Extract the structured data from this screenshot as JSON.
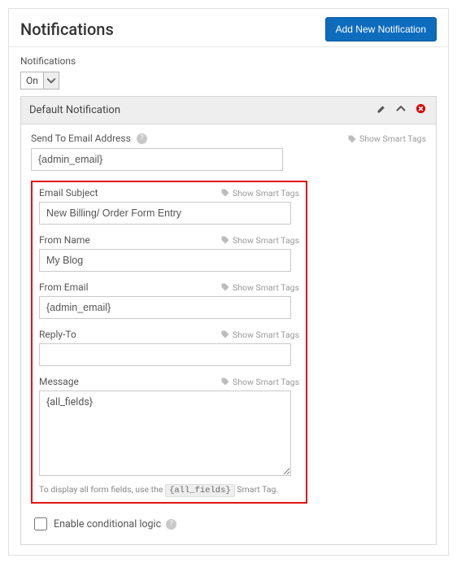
{
  "header": {
    "title": "Notifications",
    "addButton": "Add New Notification"
  },
  "toggle": {
    "label": "Notifications",
    "value": "On"
  },
  "panel": {
    "title": "Default Notification"
  },
  "smartTagsLabel": "Show Smart Tags",
  "fields": {
    "sendTo": {
      "label": "Send To Email Address",
      "value": "{admin_email}"
    },
    "subject": {
      "label": "Email Subject",
      "value": "New Billing/ Order Form Entry"
    },
    "fromName": {
      "label": "From Name",
      "value": "My Blog"
    },
    "fromEmail": {
      "label": "From Email",
      "value": "{admin_email}"
    },
    "replyTo": {
      "label": "Reply-To",
      "value": ""
    },
    "message": {
      "label": "Message",
      "value": "{all_fields}"
    }
  },
  "hint": {
    "pre": "To display all form fields, use the ",
    "code": "{all_fields}",
    "post": " Smart Tag."
  },
  "conditional": {
    "label": "Enable conditional logic"
  }
}
